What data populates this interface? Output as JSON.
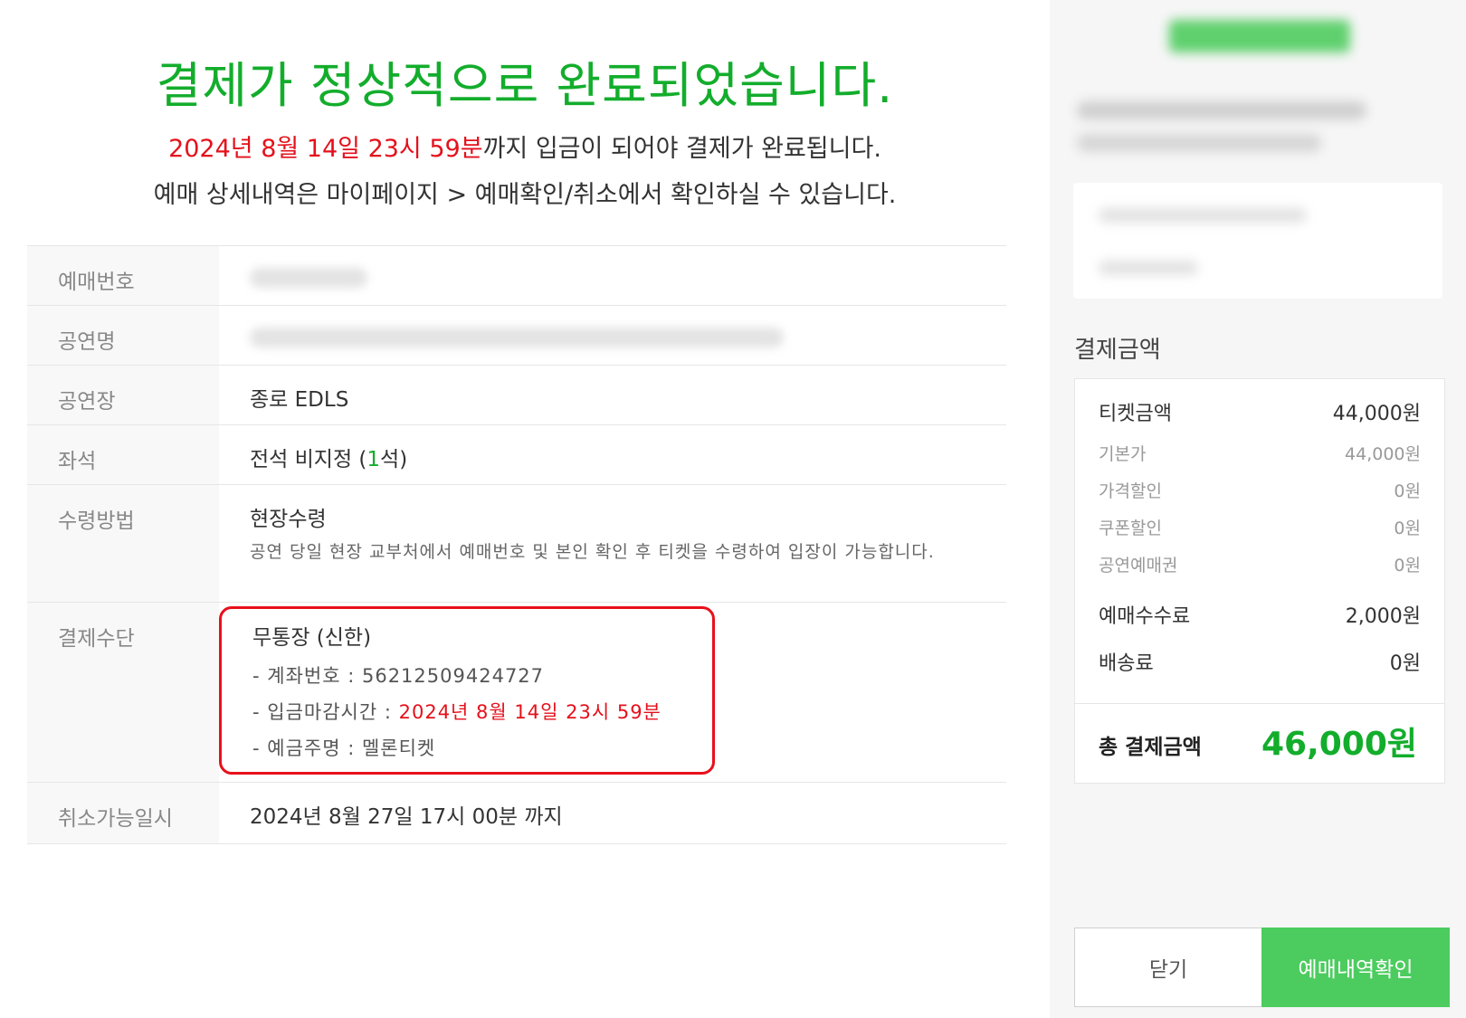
{
  "header": {
    "title": "결제가 정상적으로 완료되었습니다.",
    "deadline_date": "2024년 8월 14일 23시 59분",
    "deadline_suffix": "까지 입금이 되어야 결제가 완료됩니다.",
    "mypage_note": "예매 상세내역은 마이페이지 > 예매확인/취소에서 확인하실 수 있습니다."
  },
  "details": {
    "booking_no_label": "예매번호",
    "show_name_label": "공연명",
    "venue_label": "공연장",
    "venue_value": "종로 EDLS",
    "seat_label": "좌석",
    "seat_prefix": "전석 비지정 (",
    "seat_count": "1",
    "seat_suffix": "석)",
    "receive_label": "수령방법",
    "receive_value": "현장수령",
    "receive_desc": "공연 당일 현장 교부처에서 예매번호 및 본인 확인 후 티켓을 수령하여 입장이 가능합니다.",
    "payment_label": "결제수단",
    "payment_method": "무통장 (신한)",
    "account_label": "- 계좌번호 : ",
    "account_value": "56212509424727",
    "deposit_deadline_label": "- 입금마감시간 : ",
    "deposit_deadline_value": "2024년 8월 14일 23시 59분",
    "depositor_label": "- 예금주명 : ",
    "depositor_value": "멜론티켓",
    "cancel_label": "취소가능일시",
    "cancel_value": "2024년 8월 27일 17시 00분 까지"
  },
  "summary": {
    "heading": "결제금액",
    "ticket_label": "티켓금액",
    "ticket_value": "44,000원",
    "base_label": "기본가",
    "base_value": "44,000원",
    "price_discount_label": "가격할인",
    "price_discount_value": "0원",
    "coupon_label": "쿠폰할인",
    "coupon_value": "0원",
    "voucher_label": "공연예매권",
    "voucher_value": "0원",
    "fee_label": "예매수수료",
    "fee_value": "2,000원",
    "delivery_label": "배송료",
    "delivery_value": "0원",
    "total_label": "총 결제금액",
    "total_value": "46,000원"
  },
  "buttons": {
    "close": "닫기",
    "confirm": "예매내역확인"
  },
  "colors": {
    "accent_green": "#13ad2c",
    "alert_red": "#e4111c",
    "button_green": "#4ccc5f"
  }
}
